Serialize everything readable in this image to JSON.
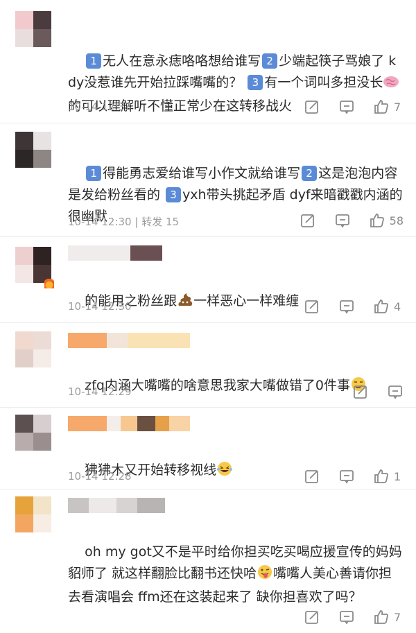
{
  "comments": [
    {
      "text": "无人在意永痣咯咯想给谁写",
      "badge1": "1",
      "badge2": "2",
      "badge3": "3",
      "seg2": "少端起筷子骂娘了 kdy没惹谁先开始拉踩嘴嘴的？",
      "seg3": "有一个词叫多担没长",
      "seg4": "的可以理解听不懂正常少在这转移战火",
      "time": "10-14 12:33",
      "likes": "7"
    },
    {
      "seg1": "得能勇志爱给谁写小作文就给谁写",
      "badge1": "1",
      "badge2": "2",
      "badge3": "3",
      "seg2": "这是泡泡内容 是发给粉丝看的",
      "seg3": "yxh带头挑起矛盾 dyf来暗戳戳内涵的很幽默",
      "time": "10-14 12:30",
      "repost": "转发 15",
      "likes": "58"
    },
    {
      "seg1": "的能用之粉丝跟",
      "seg2": "一样恶心一样难缠",
      "time": "10-14 12:30",
      "likes": "4"
    },
    {
      "seg1": "zfq内涵大嘴嘴的啥意思我家大嘴做错了0件事",
      "time": "10-14 12:29",
      "likes": ""
    },
    {
      "seg1": "狒狒木又开始转移视线",
      "time": "10-14 12:28",
      "likes": "1"
    },
    {
      "seg1": "oh my got又不是平时给你担买吃买喝应援宣传的妈妈貂师了 就这样翻脸比翻书还快哈",
      "seg2": "嘴嘴人美心善请你担去看演唱会 ffm还在这装起来了 缺你担喜欢了吗？",
      "time": "",
      "likes": "7"
    }
  ],
  "colors": {
    "badge": "#5b8bd6",
    "text": "#2b2b2b",
    "meta": "#9b9b9b"
  },
  "icons": [
    "repost-icon",
    "comment-icon",
    "like-icon"
  ]
}
